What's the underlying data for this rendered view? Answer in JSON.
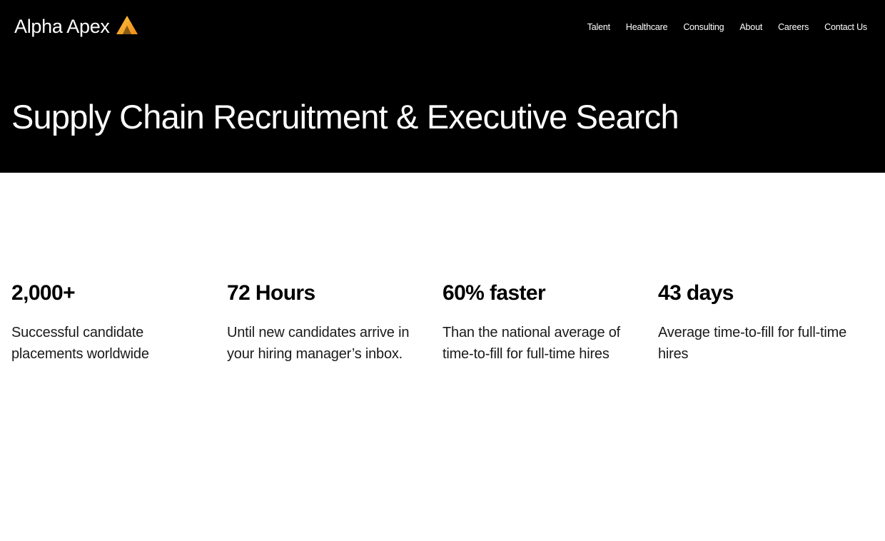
{
  "brand": {
    "name": "Alpha Apex",
    "logo_icon": "apex-a-icon",
    "logo_colors": [
      "#f9b52a",
      "#f07c1c"
    ]
  },
  "nav": {
    "items": [
      {
        "label": "Talent"
      },
      {
        "label": "Healthcare"
      },
      {
        "label": "Consulting"
      },
      {
        "label": "About"
      },
      {
        "label": "Careers"
      },
      {
        "label": "Contact Us"
      }
    ]
  },
  "hero": {
    "title": "Supply Chain Recruitment & Executive Search",
    "background": "#000000"
  },
  "stats": [
    {
      "value": "2,000+",
      "description": "Successful candidate placements worldwide"
    },
    {
      "value": "72 Hours",
      "description": "Until new candidates arrive in your hiring manager’s inbox."
    },
    {
      "value": "60% faster",
      "description": "Than the national average of time-to-fill for full-time hires"
    },
    {
      "value": "43 days",
      "description": "Average time-to-fill for full-time hires"
    }
  ]
}
